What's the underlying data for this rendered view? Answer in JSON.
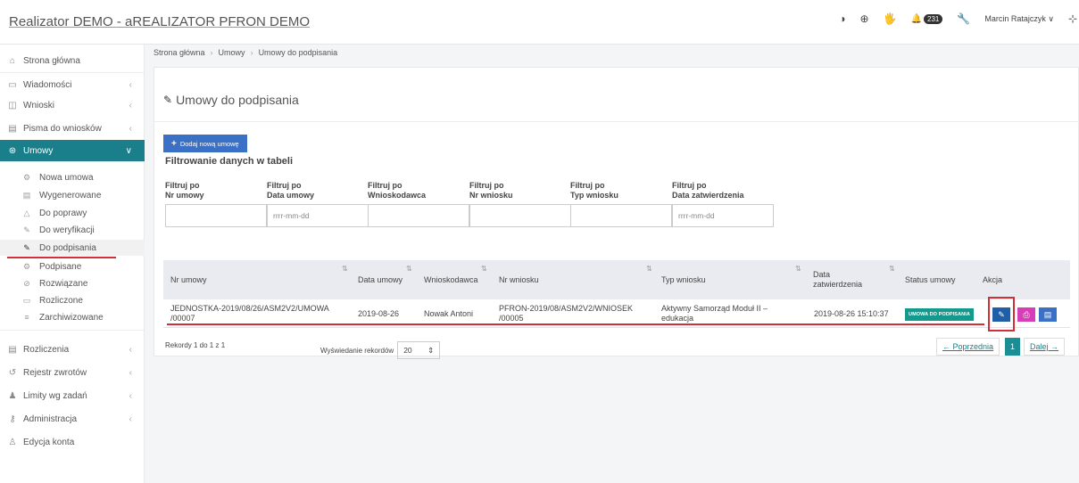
{
  "app": {
    "title": "Realizator DEMO - aREALIZATOR PFRON DEMO"
  },
  "topbar": {
    "contrast_icon": "◑",
    "zoom_icon": "⊕",
    "sign_icon": "🖐",
    "notifications_badge": "231",
    "user_name": "Marcin Ratajczyk ∨",
    "extra_icon": "⊹"
  },
  "sidebar": {
    "items": [
      {
        "label": "Strona główna",
        "icon": "⌂"
      },
      {
        "label": "Wiadomości",
        "icon": "▭"
      },
      {
        "label": "Wnioski",
        "icon": "◫"
      },
      {
        "label": "Pisma do wniosków",
        "icon": "▤"
      },
      {
        "label": "Umowy",
        "icon": "⊛"
      },
      {
        "label": "Rozliczenia",
        "icon": "▤"
      },
      {
        "label": "Rejestr zwrotów",
        "icon": "↺"
      },
      {
        "label": "Limity wg zadań",
        "icon": "♟"
      },
      {
        "label": "Administracja",
        "icon": "⚷"
      },
      {
        "label": "Edycja konta",
        "icon": "♙"
      }
    ],
    "sub_items": [
      {
        "label": "Nowa umowa",
        "icon": "⚙"
      },
      {
        "label": "Wygenerowane",
        "icon": "▤"
      },
      {
        "label": "Do poprawy",
        "icon": "△"
      },
      {
        "label": "Do weryfikacji",
        "icon": "✎"
      },
      {
        "label": "Do podpisania",
        "icon": "✎"
      },
      {
        "label": "Podpisane",
        "icon": "⚙"
      },
      {
        "label": "Rozwiązane",
        "icon": "⊘"
      },
      {
        "label": "Rozliczone",
        "icon": "▭"
      },
      {
        "label": "Zarchiwizowane",
        "icon": "≡"
      }
    ],
    "chevron": "‹",
    "chevron_open": "∨"
  },
  "breadcrumb": [
    "Strona główna",
    "Umowy",
    "Umowy do podpisania"
  ],
  "breadcrumb_sep": "›",
  "page": {
    "title": "Umowy do podpisania",
    "add_button": "Dodaj nową umowę",
    "filter_title": "Filtrowanie danych w tabeli"
  },
  "filters": [
    {
      "line1": "Filtruj po",
      "line2": "Nr umowy",
      "placeholder": ""
    },
    {
      "line1": "Filtruj po",
      "line2": "Data umowy",
      "placeholder": "rrrr-mm-dd"
    },
    {
      "line1": "Filtruj po",
      "line2": "Wnioskodawca",
      "placeholder": ""
    },
    {
      "line1": "Filtruj po",
      "line2": "Nr wniosku",
      "placeholder": ""
    },
    {
      "line1": "Filtruj po",
      "line2": "Typ wniosku",
      "placeholder": ""
    },
    {
      "line1": "Filtruj po",
      "line2": "Data zatwierdzenia",
      "placeholder": "rrrr-mm-dd"
    }
  ],
  "table": {
    "headers": [
      "Nr umowy",
      "Data umowy",
      "Wnioskodawca",
      "Nr wniosku",
      "Typ wniosku",
      "Data",
      "zatwierdzenia",
      "Status umowy",
      "Akcja"
    ],
    "sort_icon": "⇅",
    "row": {
      "nr_umowy_1": "JEDNOSTKA-2019/08/26/ASM2V2/UMOWA",
      "nr_umowy_2": "/00007",
      "data_umowy": "2019-08-26",
      "wnioskodawca": "Nowak Antoni",
      "nr_wniosku_1": "PFRON-2019/08/ASM2V2/WNIOSEK",
      "nr_wniosku_2": "/00005",
      "typ_1": "Aktywny Samorząd Moduł II –",
      "typ_2": "edukacja",
      "data_zatwierdzenia": "2019-08-26 15:10:37",
      "status": "UMOWA DO PODPISANIA"
    },
    "actions": {
      "edit_icon": "✎",
      "print_icon": "⎙",
      "details_icon": "▤"
    }
  },
  "footer": {
    "records": "Rekordy 1 do 1 z 1",
    "show_label": "Wyświedanie rekordów",
    "page_size": "20",
    "page_size_arrow": "⇕",
    "prev": "← Poprzednia",
    "current": "1",
    "next": "Dalej →"
  },
  "colors": {
    "accent": "#1a7f8a",
    "add_button": "#3a70c5",
    "status": "#149a8c",
    "edit": "#1f5fa8",
    "print": "#d63db7",
    "details": "#3a70c5",
    "highlight": "#d32f3a"
  }
}
